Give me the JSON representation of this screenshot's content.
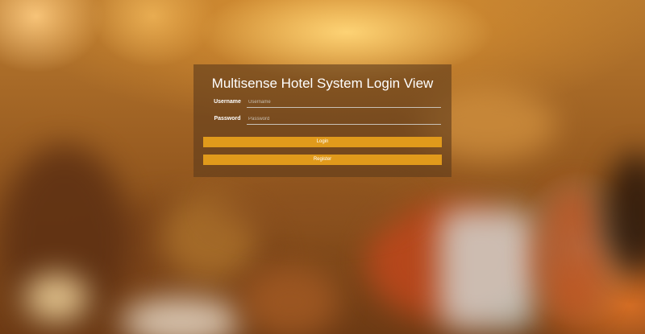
{
  "background": {
    "description": "blurred hotel room"
  },
  "login": {
    "title": "Multisense Hotel System Login View",
    "username": {
      "label": "Username",
      "placeholder": "Username",
      "value": ""
    },
    "password": {
      "label": "Password",
      "placeholder": "Password",
      "value": ""
    },
    "login_button": "Login",
    "register_button": "Register"
  },
  "colors": {
    "accent": "#e19a1b",
    "panel": "rgba(95,60,28,0.62)",
    "text": "#ffffff"
  }
}
